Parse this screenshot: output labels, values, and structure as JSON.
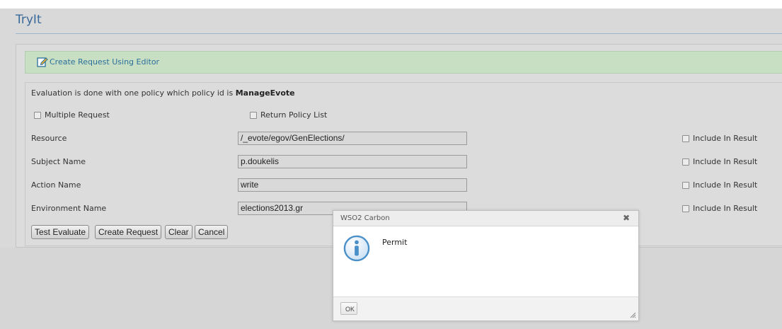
{
  "page": {
    "title": "TryIt"
  },
  "editor": {
    "link_label": "Create Request Using Editor"
  },
  "info": {
    "prefix": "Evaluation is done with one policy which policy id is",
    "policy_id": "ManageEvote"
  },
  "options": {
    "multiple_request": "Multiple Request",
    "return_policy_list": "Return Policy List"
  },
  "fields": [
    {
      "label": "Resource",
      "value": "/_evote/egov/GenElections/",
      "include_label": "Include In Result"
    },
    {
      "label": "Subject Name",
      "value": "p.doukelis",
      "include_label": "Include In Result"
    },
    {
      "label": "Action Name",
      "value": "write",
      "include_label": "Include In Result"
    },
    {
      "label": "Environment Name",
      "value": "elections2013.gr",
      "include_label": "Include In Result"
    }
  ],
  "buttons": {
    "test_evaluate": "Test Evaluate",
    "create_request": "Create Request",
    "clear": "Clear",
    "cancel": "Cancel"
  },
  "dialog": {
    "title": "WSO2 Carbon",
    "message": "Permit",
    "ok_label": "OK",
    "close_glyph": "✖",
    "icon": "info-icon"
  },
  "colors": {
    "title": "#3a6a9a",
    "editor_bar": "#c9dfc4",
    "link": "#2a6f9a",
    "info_icon": "#4a90c8"
  }
}
